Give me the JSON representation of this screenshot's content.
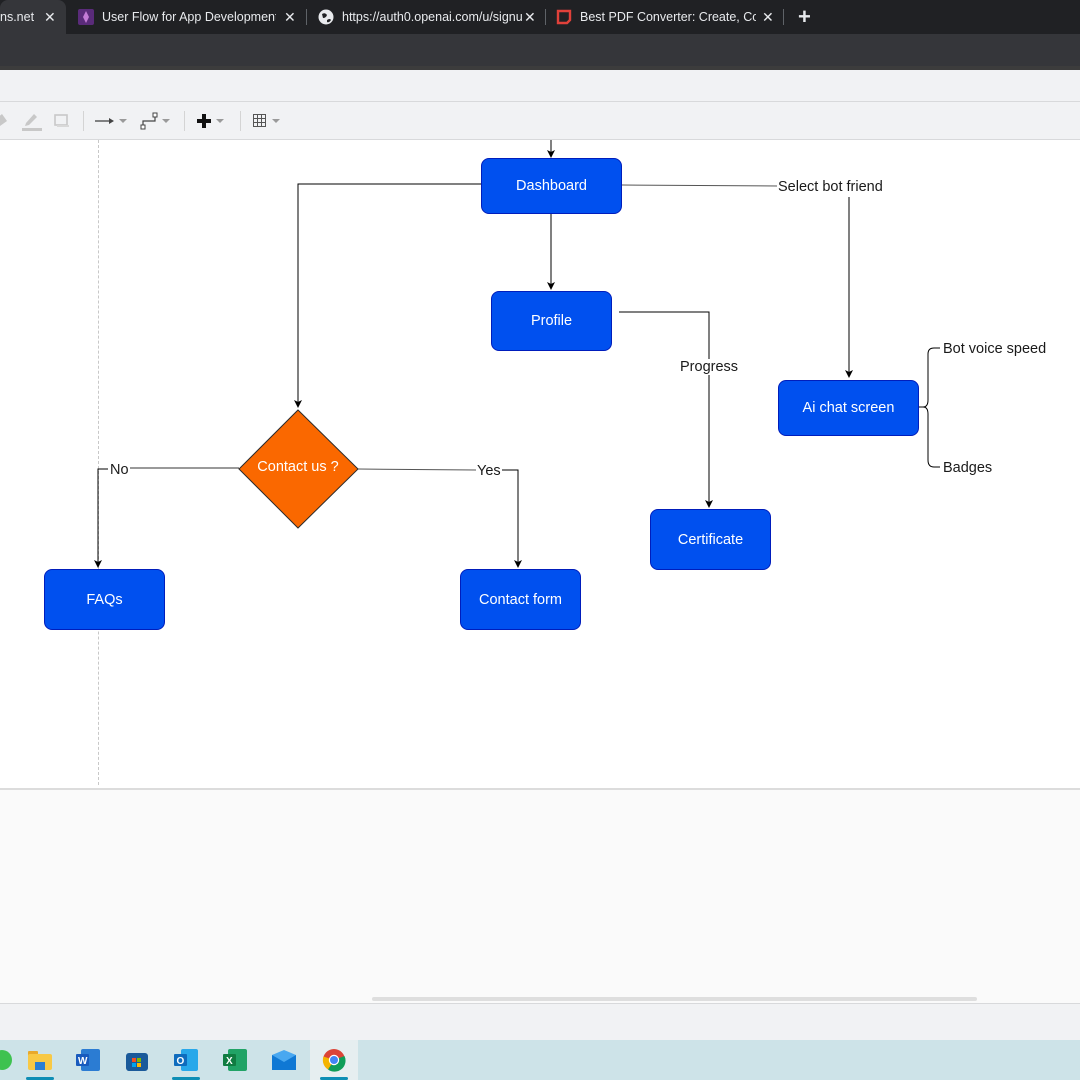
{
  "browser": {
    "tabs": [
      {
        "title": "ns.net",
        "active": true,
        "favicon": "drawio-icon"
      },
      {
        "title": "User Flow for App Development:",
        "active": false,
        "favicon": "figma-community-icon"
      },
      {
        "title": "https://auth0.openai.com/u/signu",
        "active": false,
        "favicon": "globe-icon"
      },
      {
        "title": "Best PDF Converter: Create, Conv",
        "active": false,
        "favicon": "pdf-converter-icon"
      }
    ],
    "close_glyph": "✕",
    "new_tab_glyph": "+"
  },
  "toolbar": {
    "items": [
      {
        "name": "fill-color",
        "icon": "paint-bucket-icon"
      },
      {
        "name": "line-color",
        "icon": "pencil-icon"
      },
      {
        "name": "shadow",
        "icon": "shadow-box-icon"
      },
      {
        "name": "connection",
        "icon": "arrow-right-icon"
      },
      {
        "name": "waypoints",
        "icon": "waypoint-connector-icon"
      },
      {
        "name": "insert",
        "icon": "plus-icon"
      },
      {
        "name": "table",
        "icon": "table-grid-icon"
      }
    ]
  },
  "diagram": {
    "colors": {
      "process": "#0050ef",
      "process_border": "#001dbc",
      "decision": "#fa6800",
      "decision_border": "#2b2b2b",
      "edge": "#000000"
    },
    "nodes": {
      "dashboard": "Dashboard",
      "profile": "Profile",
      "ai_chat": "Ai chat screen",
      "certificate": "Certificate",
      "contact_decision": "Contact us ?",
      "faqs": "FAQs",
      "contact_form": "Contact form"
    },
    "edge_labels": {
      "select_bot": "Select bot friend",
      "progress": "Progress",
      "no": "No",
      "yes": "Yes",
      "bot_voice": "Bot voice speed",
      "badges": "Badges"
    }
  },
  "taskbar": {
    "apps": [
      "whatsapp",
      "file-explorer",
      "word",
      "microsoft-store",
      "outlook",
      "excel",
      "mail",
      "chrome"
    ],
    "active": "chrome"
  }
}
